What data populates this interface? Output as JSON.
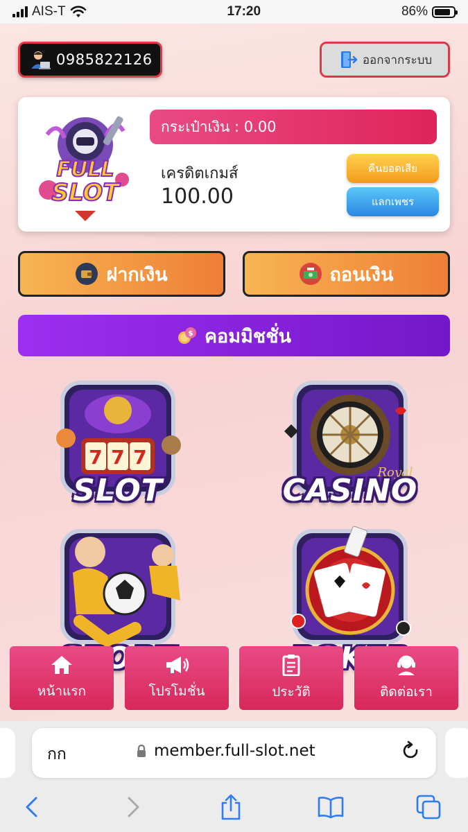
{
  "status_bar": {
    "carrier": "AIS-T",
    "time": "17:20",
    "battery": "86%",
    "battery_level": 0.86
  },
  "header": {
    "phone": "0985822126",
    "logout_label": "ออกจากระบบ"
  },
  "wallet": {
    "brand_line1": "FULL",
    "brand_line2": "SLOT",
    "wallet_text": "กระเป๋าเงิน : 0.00",
    "credit_label": "เครดิตเกมส์",
    "credit_value": "100.00",
    "rebate_label": "คืนยอดเสีย",
    "diamond_label": "แลกเพชร"
  },
  "actions": {
    "deposit_label": "ฝากเงิน",
    "withdraw_label": "ถอนเงิน",
    "commission_label": "คอมมิชชั่น"
  },
  "games": {
    "slot": "SLOT",
    "casino": "CASINO",
    "casino_sub": "Royal",
    "sport": "SPORT",
    "poker": "POKER"
  },
  "bottom_nav": {
    "home": "หน้าแรก",
    "promotion": "โปรโมชั่น",
    "history": "ประวัติ",
    "contact": "ติดต่อเรา"
  },
  "browser": {
    "aa_label": "กก",
    "url": "member.full-slot.net"
  },
  "colors": {
    "accent_pink": "#e0235b",
    "accent_orange": "#ef7e36",
    "accent_purple": "#7417c9",
    "ios_blue": "#2f7cf6"
  }
}
